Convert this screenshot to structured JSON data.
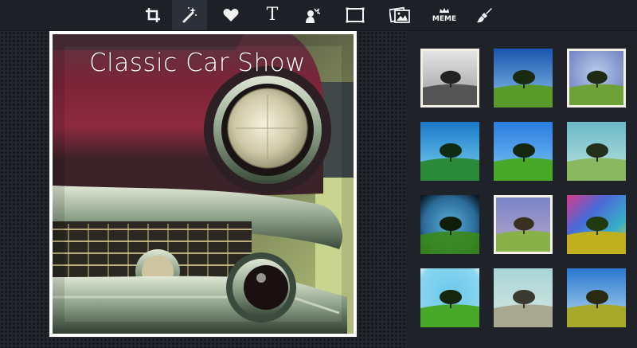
{
  "toolbar": {
    "tools": [
      {
        "name": "crop-icon",
        "label": ""
      },
      {
        "name": "magic-wand-icon",
        "label": "",
        "active": true
      },
      {
        "name": "heart-icon",
        "label": ""
      },
      {
        "name": "text-icon",
        "label": "T"
      },
      {
        "name": "overlay-icon",
        "label": ""
      },
      {
        "name": "frame-icon",
        "label": ""
      },
      {
        "name": "photo-icon",
        "label": ""
      },
      {
        "name": "meme-icon",
        "label": "MEME"
      },
      {
        "name": "brush-icon",
        "label": ""
      }
    ]
  },
  "canvas": {
    "title_text": "Classic Car Show"
  },
  "filters": {
    "thumbs": [
      {
        "name": "filter-bw",
        "style": "bw"
      },
      {
        "name": "filter-vivid",
        "style": "vivid"
      },
      {
        "name": "filter-soft-framed",
        "style": "soft"
      },
      {
        "name": "filter-cyan",
        "style": "cyan"
      },
      {
        "name": "filter-bright",
        "style": "bright"
      },
      {
        "name": "filter-pale",
        "style": "pale"
      },
      {
        "name": "filter-vignette",
        "style": "vignette"
      },
      {
        "name": "filter-vintage-framed",
        "style": "vintage"
      },
      {
        "name": "filter-rainbow",
        "style": "rainbow"
      },
      {
        "name": "filter-glow",
        "style": "glow"
      },
      {
        "name": "filter-faded",
        "style": "faded"
      },
      {
        "name": "filter-warm",
        "style": "warm"
      }
    ]
  }
}
